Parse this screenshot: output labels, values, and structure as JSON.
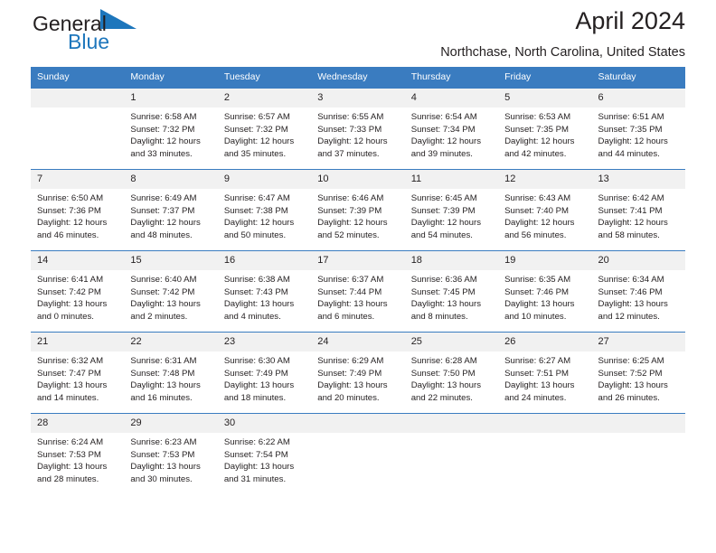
{
  "brand": {
    "name_part1": "General",
    "name_part2": "Blue",
    "triangle_color": "#1d76bc"
  },
  "header": {
    "title": "April 2024",
    "subtitle": "Northchase, North Carolina, United States"
  },
  "theme": {
    "header_blue": "#3a7cc0",
    "daynum_bg": "#f1f1f1",
    "text": "#231f20"
  },
  "weekdays": [
    "Sunday",
    "Monday",
    "Tuesday",
    "Wednesday",
    "Thursday",
    "Friday",
    "Saturday"
  ],
  "weeks": [
    [
      {
        "day": "",
        "sunrise": "",
        "sunset": "",
        "daylight1": "",
        "daylight2": ""
      },
      {
        "day": "1",
        "sunrise": "Sunrise: 6:58 AM",
        "sunset": "Sunset: 7:32 PM",
        "daylight1": "Daylight: 12 hours",
        "daylight2": "and 33 minutes."
      },
      {
        "day": "2",
        "sunrise": "Sunrise: 6:57 AM",
        "sunset": "Sunset: 7:32 PM",
        "daylight1": "Daylight: 12 hours",
        "daylight2": "and 35 minutes."
      },
      {
        "day": "3",
        "sunrise": "Sunrise: 6:55 AM",
        "sunset": "Sunset: 7:33 PM",
        "daylight1": "Daylight: 12 hours",
        "daylight2": "and 37 minutes."
      },
      {
        "day": "4",
        "sunrise": "Sunrise: 6:54 AM",
        "sunset": "Sunset: 7:34 PM",
        "daylight1": "Daylight: 12 hours",
        "daylight2": "and 39 minutes."
      },
      {
        "day": "5",
        "sunrise": "Sunrise: 6:53 AM",
        "sunset": "Sunset: 7:35 PM",
        "daylight1": "Daylight: 12 hours",
        "daylight2": "and 42 minutes."
      },
      {
        "day": "6",
        "sunrise": "Sunrise: 6:51 AM",
        "sunset": "Sunset: 7:35 PM",
        "daylight1": "Daylight: 12 hours",
        "daylight2": "and 44 minutes."
      }
    ],
    [
      {
        "day": "7",
        "sunrise": "Sunrise: 6:50 AM",
        "sunset": "Sunset: 7:36 PM",
        "daylight1": "Daylight: 12 hours",
        "daylight2": "and 46 minutes."
      },
      {
        "day": "8",
        "sunrise": "Sunrise: 6:49 AM",
        "sunset": "Sunset: 7:37 PM",
        "daylight1": "Daylight: 12 hours",
        "daylight2": "and 48 minutes."
      },
      {
        "day": "9",
        "sunrise": "Sunrise: 6:47 AM",
        "sunset": "Sunset: 7:38 PM",
        "daylight1": "Daylight: 12 hours",
        "daylight2": "and 50 minutes."
      },
      {
        "day": "10",
        "sunrise": "Sunrise: 6:46 AM",
        "sunset": "Sunset: 7:39 PM",
        "daylight1": "Daylight: 12 hours",
        "daylight2": "and 52 minutes."
      },
      {
        "day": "11",
        "sunrise": "Sunrise: 6:45 AM",
        "sunset": "Sunset: 7:39 PM",
        "daylight1": "Daylight: 12 hours",
        "daylight2": "and 54 minutes."
      },
      {
        "day": "12",
        "sunrise": "Sunrise: 6:43 AM",
        "sunset": "Sunset: 7:40 PM",
        "daylight1": "Daylight: 12 hours",
        "daylight2": "and 56 minutes."
      },
      {
        "day": "13",
        "sunrise": "Sunrise: 6:42 AM",
        "sunset": "Sunset: 7:41 PM",
        "daylight1": "Daylight: 12 hours",
        "daylight2": "and 58 minutes."
      }
    ],
    [
      {
        "day": "14",
        "sunrise": "Sunrise: 6:41 AM",
        "sunset": "Sunset: 7:42 PM",
        "daylight1": "Daylight: 13 hours",
        "daylight2": "and 0 minutes."
      },
      {
        "day": "15",
        "sunrise": "Sunrise: 6:40 AM",
        "sunset": "Sunset: 7:42 PM",
        "daylight1": "Daylight: 13 hours",
        "daylight2": "and 2 minutes."
      },
      {
        "day": "16",
        "sunrise": "Sunrise: 6:38 AM",
        "sunset": "Sunset: 7:43 PM",
        "daylight1": "Daylight: 13 hours",
        "daylight2": "and 4 minutes."
      },
      {
        "day": "17",
        "sunrise": "Sunrise: 6:37 AM",
        "sunset": "Sunset: 7:44 PM",
        "daylight1": "Daylight: 13 hours",
        "daylight2": "and 6 minutes."
      },
      {
        "day": "18",
        "sunrise": "Sunrise: 6:36 AM",
        "sunset": "Sunset: 7:45 PM",
        "daylight1": "Daylight: 13 hours",
        "daylight2": "and 8 minutes."
      },
      {
        "day": "19",
        "sunrise": "Sunrise: 6:35 AM",
        "sunset": "Sunset: 7:46 PM",
        "daylight1": "Daylight: 13 hours",
        "daylight2": "and 10 minutes."
      },
      {
        "day": "20",
        "sunrise": "Sunrise: 6:34 AM",
        "sunset": "Sunset: 7:46 PM",
        "daylight1": "Daylight: 13 hours",
        "daylight2": "and 12 minutes."
      }
    ],
    [
      {
        "day": "21",
        "sunrise": "Sunrise: 6:32 AM",
        "sunset": "Sunset: 7:47 PM",
        "daylight1": "Daylight: 13 hours",
        "daylight2": "and 14 minutes."
      },
      {
        "day": "22",
        "sunrise": "Sunrise: 6:31 AM",
        "sunset": "Sunset: 7:48 PM",
        "daylight1": "Daylight: 13 hours",
        "daylight2": "and 16 minutes."
      },
      {
        "day": "23",
        "sunrise": "Sunrise: 6:30 AM",
        "sunset": "Sunset: 7:49 PM",
        "daylight1": "Daylight: 13 hours",
        "daylight2": "and 18 minutes."
      },
      {
        "day": "24",
        "sunrise": "Sunrise: 6:29 AM",
        "sunset": "Sunset: 7:49 PM",
        "daylight1": "Daylight: 13 hours",
        "daylight2": "and 20 minutes."
      },
      {
        "day": "25",
        "sunrise": "Sunrise: 6:28 AM",
        "sunset": "Sunset: 7:50 PM",
        "daylight1": "Daylight: 13 hours",
        "daylight2": "and 22 minutes."
      },
      {
        "day": "26",
        "sunrise": "Sunrise: 6:27 AM",
        "sunset": "Sunset: 7:51 PM",
        "daylight1": "Daylight: 13 hours",
        "daylight2": "and 24 minutes."
      },
      {
        "day": "27",
        "sunrise": "Sunrise: 6:25 AM",
        "sunset": "Sunset: 7:52 PM",
        "daylight1": "Daylight: 13 hours",
        "daylight2": "and 26 minutes."
      }
    ],
    [
      {
        "day": "28",
        "sunrise": "Sunrise: 6:24 AM",
        "sunset": "Sunset: 7:53 PM",
        "daylight1": "Daylight: 13 hours",
        "daylight2": "and 28 minutes."
      },
      {
        "day": "29",
        "sunrise": "Sunrise: 6:23 AM",
        "sunset": "Sunset: 7:53 PM",
        "daylight1": "Daylight: 13 hours",
        "daylight2": "and 30 minutes."
      },
      {
        "day": "30",
        "sunrise": "Sunrise: 6:22 AM",
        "sunset": "Sunset: 7:54 PM",
        "daylight1": "Daylight: 13 hours",
        "daylight2": "and 31 minutes."
      },
      {
        "day": "",
        "sunrise": "",
        "sunset": "",
        "daylight1": "",
        "daylight2": ""
      },
      {
        "day": "",
        "sunrise": "",
        "sunset": "",
        "daylight1": "",
        "daylight2": ""
      },
      {
        "day": "",
        "sunrise": "",
        "sunset": "",
        "daylight1": "",
        "daylight2": ""
      },
      {
        "day": "",
        "sunrise": "",
        "sunset": "",
        "daylight1": "",
        "daylight2": ""
      }
    ]
  ]
}
